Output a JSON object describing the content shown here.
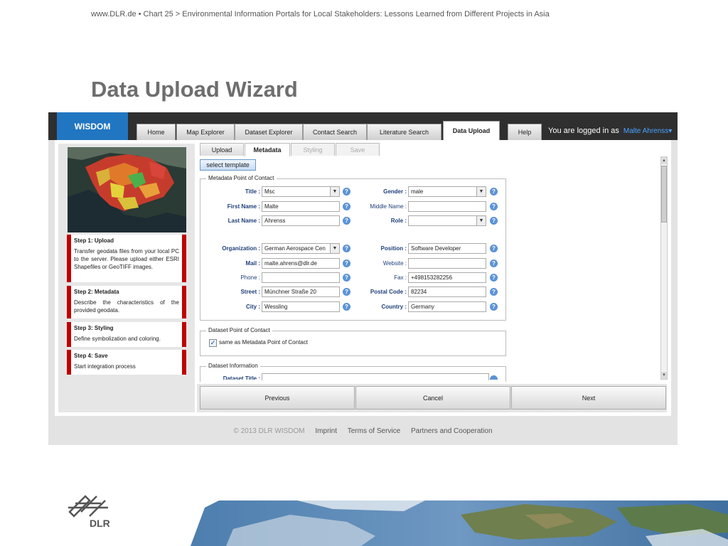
{
  "slide": {
    "header": "www.DLR.de  •  Chart 25   > Environmental Information Portals for Local Stakeholders: Lessons Learned from Different Projects in Asia",
    "title": "Data Upload Wizard",
    "logo_text": "DLR"
  },
  "app": {
    "brand": "WISDOM",
    "nav_tabs": [
      "Home",
      "Map Explorer",
      "Dataset Explorer",
      "Contact Search",
      "Literature Search",
      "Data Upload",
      "Help"
    ],
    "active_tab": "Data Upload",
    "login_text": "You are logged in as",
    "user": "Malte Ahrenss",
    "user_caret": "▾"
  },
  "wizard": {
    "subtabs": [
      "Upload",
      "Metadata",
      "Styling",
      "Save"
    ],
    "active_subtab": "Metadata",
    "disabled_subtabs": [
      "Styling",
      "Save"
    ],
    "steps": [
      {
        "title": "Step 1: Upload",
        "desc": "Transfer geodata files from your local PC to the server. Please upload either ESRI Shapefiles or GeoTIFF images."
      },
      {
        "title": "Step 2: Metadata",
        "desc": "Describe the characteristics of the provided geodata."
      },
      {
        "title": "Step 3: Styling",
        "desc": "Define symbolization and coloring."
      },
      {
        "title": "Step 4: Save",
        "desc": "Start integration process"
      }
    ],
    "template_button": "select template",
    "metadata_contact": {
      "legend": "Metadata Point of Contact",
      "title_label": "Title :",
      "title_value": "Msc",
      "gender_label": "Gender :",
      "gender_value": "male",
      "first_name_label": "First Name :",
      "first_name_value": "Malte",
      "middle_name_label": "Middle Name :",
      "middle_name_value": "",
      "last_name_label": "Last Name :",
      "last_name_value": "Ahrenss",
      "role_label": "Role :",
      "role_value": "",
      "organization_label": "Organization :",
      "organization_value": "German Aerospace Cen",
      "position_label": "Position :",
      "position_value": "Software Developer",
      "mail_label": "Mail :",
      "mail_value": "malte.ahrens@dlr.de",
      "website_label": "Website :",
      "website_value": "",
      "phone_label": "Phone :",
      "phone_value": "",
      "fax_label": "Fax :",
      "fax_value": "+498153282256",
      "street_label": "Street :",
      "street_value": "Münchner Straße  20",
      "postal_label": "Postal Code :",
      "postal_value": "82234",
      "city_label": "City :",
      "city_value": "Wessling",
      "country_label": "Country :",
      "country_value": "Germany"
    },
    "dataset_contact": {
      "legend": "Dataset Point of Contact",
      "checkbox_label": "same as Metadata Point of Contact",
      "checked": true
    },
    "dataset_info": {
      "legend": "Dataset Information",
      "title_label": "Dataset Title :"
    },
    "buttons": {
      "previous": "Previous",
      "cancel": "Cancel",
      "next": "Next"
    }
  },
  "footer": {
    "copyright": "© 2013 DLR WISDOM",
    "links": [
      "Imprint",
      "Terms of Service",
      "Partners and Cooperation"
    ]
  },
  "colors": {
    "brand": "#2176c1",
    "step_accent": "#c20000",
    "label": "#1f3f7a",
    "help": "#5b93d6"
  }
}
